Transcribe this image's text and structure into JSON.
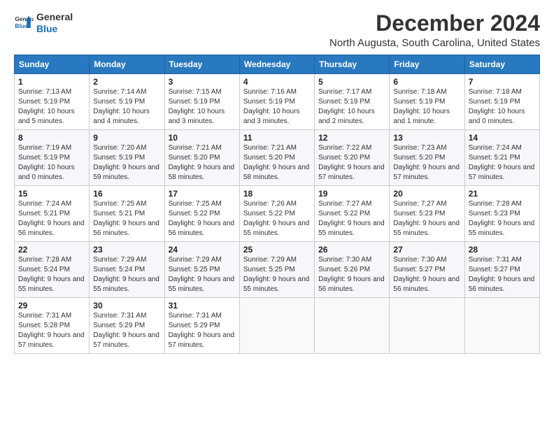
{
  "logo": {
    "line1": "General",
    "line2": "Blue"
  },
  "title": "December 2024",
  "subtitle": "North Augusta, South Carolina, United States",
  "headers": [
    "Sunday",
    "Monday",
    "Tuesday",
    "Wednesday",
    "Thursday",
    "Friday",
    "Saturday"
  ],
  "weeks": [
    [
      {
        "day": "1",
        "sunrise": "Sunrise: 7:13 AM",
        "sunset": "Sunset: 5:19 PM",
        "daylight": "Daylight: 10 hours and 5 minutes."
      },
      {
        "day": "2",
        "sunrise": "Sunrise: 7:14 AM",
        "sunset": "Sunset: 5:19 PM",
        "daylight": "Daylight: 10 hours and 4 minutes."
      },
      {
        "day": "3",
        "sunrise": "Sunrise: 7:15 AM",
        "sunset": "Sunset: 5:19 PM",
        "daylight": "Daylight: 10 hours and 3 minutes."
      },
      {
        "day": "4",
        "sunrise": "Sunrise: 7:16 AM",
        "sunset": "Sunset: 5:19 PM",
        "daylight": "Daylight: 10 hours and 3 minutes."
      },
      {
        "day": "5",
        "sunrise": "Sunrise: 7:17 AM",
        "sunset": "Sunset: 5:19 PM",
        "daylight": "Daylight: 10 hours and 2 minutes."
      },
      {
        "day": "6",
        "sunrise": "Sunrise: 7:18 AM",
        "sunset": "Sunset: 5:19 PM",
        "daylight": "Daylight: 10 hours and 1 minute."
      },
      {
        "day": "7",
        "sunrise": "Sunrise: 7:18 AM",
        "sunset": "Sunset: 5:19 PM",
        "daylight": "Daylight: 10 hours and 0 minutes."
      }
    ],
    [
      {
        "day": "8",
        "sunrise": "Sunrise: 7:19 AM",
        "sunset": "Sunset: 5:19 PM",
        "daylight": "Daylight: 10 hours and 0 minutes."
      },
      {
        "day": "9",
        "sunrise": "Sunrise: 7:20 AM",
        "sunset": "Sunset: 5:19 PM",
        "daylight": "Daylight: 9 hours and 59 minutes."
      },
      {
        "day": "10",
        "sunrise": "Sunrise: 7:21 AM",
        "sunset": "Sunset: 5:20 PM",
        "daylight": "Daylight: 9 hours and 58 minutes."
      },
      {
        "day": "11",
        "sunrise": "Sunrise: 7:21 AM",
        "sunset": "Sunset: 5:20 PM",
        "daylight": "Daylight: 9 hours and 58 minutes."
      },
      {
        "day": "12",
        "sunrise": "Sunrise: 7:22 AM",
        "sunset": "Sunset: 5:20 PM",
        "daylight": "Daylight: 9 hours and 57 minutes."
      },
      {
        "day": "13",
        "sunrise": "Sunrise: 7:23 AM",
        "sunset": "Sunset: 5:20 PM",
        "daylight": "Daylight: 9 hours and 57 minutes."
      },
      {
        "day": "14",
        "sunrise": "Sunrise: 7:24 AM",
        "sunset": "Sunset: 5:21 PM",
        "daylight": "Daylight: 9 hours and 57 minutes."
      }
    ],
    [
      {
        "day": "15",
        "sunrise": "Sunrise: 7:24 AM",
        "sunset": "Sunset: 5:21 PM",
        "daylight": "Daylight: 9 hours and 56 minutes."
      },
      {
        "day": "16",
        "sunrise": "Sunrise: 7:25 AM",
        "sunset": "Sunset: 5:21 PM",
        "daylight": "Daylight: 9 hours and 56 minutes."
      },
      {
        "day": "17",
        "sunrise": "Sunrise: 7:25 AM",
        "sunset": "Sunset: 5:22 PM",
        "daylight": "Daylight: 9 hours and 56 minutes."
      },
      {
        "day": "18",
        "sunrise": "Sunrise: 7:26 AM",
        "sunset": "Sunset: 5:22 PM",
        "daylight": "Daylight: 9 hours and 55 minutes."
      },
      {
        "day": "19",
        "sunrise": "Sunrise: 7:27 AM",
        "sunset": "Sunset: 5:22 PM",
        "daylight": "Daylight: 9 hours and 55 minutes."
      },
      {
        "day": "20",
        "sunrise": "Sunrise: 7:27 AM",
        "sunset": "Sunset: 5:23 PM",
        "daylight": "Daylight: 9 hours and 55 minutes."
      },
      {
        "day": "21",
        "sunrise": "Sunrise: 7:28 AM",
        "sunset": "Sunset: 5:23 PM",
        "daylight": "Daylight: 9 hours and 55 minutes."
      }
    ],
    [
      {
        "day": "22",
        "sunrise": "Sunrise: 7:28 AM",
        "sunset": "Sunset: 5:24 PM",
        "daylight": "Daylight: 9 hours and 55 minutes."
      },
      {
        "day": "23",
        "sunrise": "Sunrise: 7:29 AM",
        "sunset": "Sunset: 5:24 PM",
        "daylight": "Daylight: 9 hours and 55 minutes."
      },
      {
        "day": "24",
        "sunrise": "Sunrise: 7:29 AM",
        "sunset": "Sunset: 5:25 PM",
        "daylight": "Daylight: 9 hours and 55 minutes."
      },
      {
        "day": "25",
        "sunrise": "Sunrise: 7:29 AM",
        "sunset": "Sunset: 5:25 PM",
        "daylight": "Daylight: 9 hours and 55 minutes."
      },
      {
        "day": "26",
        "sunrise": "Sunrise: 7:30 AM",
        "sunset": "Sunset: 5:26 PM",
        "daylight": "Daylight: 9 hours and 56 minutes."
      },
      {
        "day": "27",
        "sunrise": "Sunrise: 7:30 AM",
        "sunset": "Sunset: 5:27 PM",
        "daylight": "Daylight: 9 hours and 56 minutes."
      },
      {
        "day": "28",
        "sunrise": "Sunrise: 7:31 AM",
        "sunset": "Sunset: 5:27 PM",
        "daylight": "Daylight: 9 hours and 56 minutes."
      }
    ],
    [
      {
        "day": "29",
        "sunrise": "Sunrise: 7:31 AM",
        "sunset": "Sunset: 5:28 PM",
        "daylight": "Daylight: 9 hours and 57 minutes."
      },
      {
        "day": "30",
        "sunrise": "Sunrise: 7:31 AM",
        "sunset": "Sunset: 5:29 PM",
        "daylight": "Daylight: 9 hours and 57 minutes."
      },
      {
        "day": "31",
        "sunrise": "Sunrise: 7:31 AM",
        "sunset": "Sunset: 5:29 PM",
        "daylight": "Daylight: 9 hours and 57 minutes."
      },
      null,
      null,
      null,
      null
    ]
  ]
}
